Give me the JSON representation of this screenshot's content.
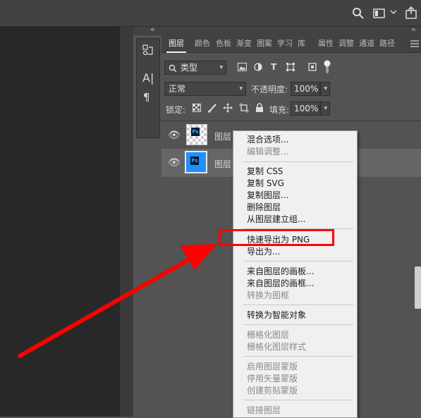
{
  "topbar": {
    "icons": [
      "search-icon",
      "workspace-icon",
      "chevron-down-icon",
      "share-icon"
    ]
  },
  "collapse_icon": "«",
  "tools_strip": {
    "icons": [
      "history-icon",
      "character-icon",
      "paragraph-icon"
    ],
    "character_glyph": "A|",
    "paragraph_glyph": "¶"
  },
  "panel": {
    "tabs": [
      "图层",
      "颜色",
      "色板",
      "渐变",
      "图案",
      "学习",
      "库",
      "属性",
      "调整",
      "通道",
      "路径"
    ],
    "filter_label": "类型",
    "blend_mode": "正常",
    "opacity_label": "不透明度:",
    "opacity_value": "100%",
    "lock_label": "锁定:",
    "fill_label": "填充:",
    "fill_value": "100%",
    "filter_icons": [
      "image-filter-icon",
      "adjustment-filter-icon",
      "type-filter-icon",
      "shape-filter-icon",
      "smart-object-filter-icon",
      "toggle-filter-icon"
    ],
    "lock_icons": [
      "lock-pixels-icon",
      "lock-image-icon",
      "lock-position-icon",
      "lock-artboard-icon",
      "lock-all-icon"
    ]
  },
  "layers": [
    {
      "name": "图层",
      "thumb": "transparent",
      "badge": "Ps"
    },
    {
      "name": "图层",
      "thumb": "blue",
      "badge": "Ps"
    }
  ],
  "context_menu": {
    "groups": [
      [
        {
          "label": "混合选项...",
          "enabled": true
        },
        {
          "label": "编辑调整...",
          "enabled": false
        }
      ],
      [
        {
          "label": "复制 CSS",
          "enabled": true
        },
        {
          "label": "复制 SVG",
          "enabled": true
        },
        {
          "label": "复制图层...",
          "enabled": true
        },
        {
          "label": "删除图层",
          "enabled": true
        },
        {
          "label": "从图层建立组...",
          "enabled": true
        }
      ],
      [
        {
          "label": "快速导出为 PNG",
          "enabled": true
        },
        {
          "label": "导出为...",
          "enabled": true
        }
      ],
      [
        {
          "label": "来自图层的画板...",
          "enabled": true
        },
        {
          "label": "来自图层的画框...",
          "enabled": true
        },
        {
          "label": "转换为图框",
          "enabled": false
        }
      ],
      [
        {
          "label": "转换为智能对象",
          "enabled": true
        }
      ],
      [
        {
          "label": "栅格化图层",
          "enabled": false
        },
        {
          "label": "栅格化图层样式",
          "enabled": false
        }
      ],
      [
        {
          "label": "启用图层蒙版",
          "enabled": false
        },
        {
          "label": "停用矢量蒙版",
          "enabled": false
        },
        {
          "label": "创建剪贴蒙版",
          "enabled": false
        }
      ],
      [
        {
          "label": "链接图层",
          "enabled": false
        }
      ]
    ]
  },
  "colors": {
    "highlight": "#ff0000",
    "arrow": "#ff0000",
    "layer_blue": "#1e90ff",
    "ps_badge_bg": "#001e36",
    "ps_badge_fg": "#31a8ff"
  }
}
